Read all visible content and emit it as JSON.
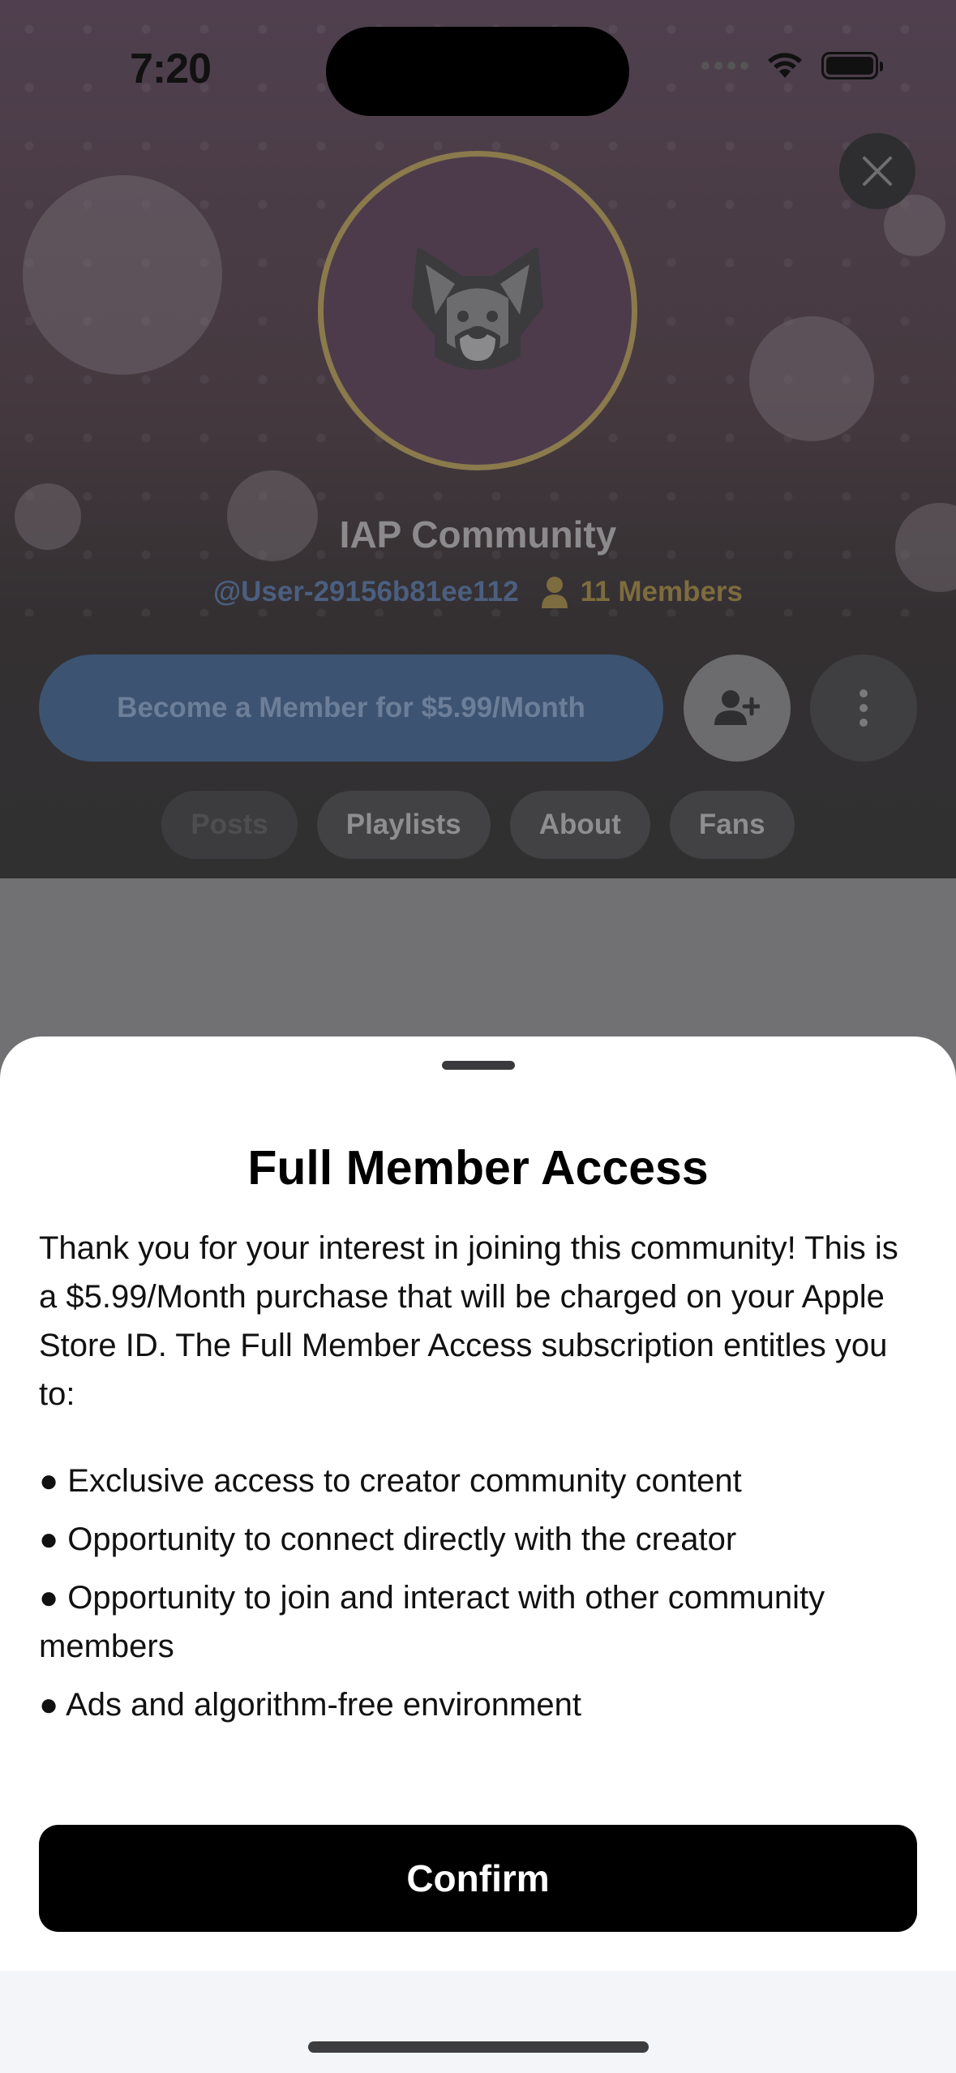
{
  "status_bar": {
    "time": "7:20"
  },
  "community": {
    "name": "IAP Community",
    "username": "@User-29156b81ee112",
    "members": "11 Members",
    "member_button": "Become a Member for $5.99/Month",
    "tabs": [
      "Posts",
      "Playlists",
      "About",
      "Fans"
    ],
    "active_tab": "Posts"
  },
  "sheet": {
    "title": "Full Member Access",
    "body": "Thank you for your interest in joining this community! This is a $5.99/Month purchase that will be charged on your Apple Store ID. The Full Member Access subscription entitles you to:",
    "bullets": [
      "Exclusive access to creator community content",
      "Opportunity to connect directly with the creator",
      "Opportunity to join and interact with other community members",
      "Ads and algorithm-free environment"
    ],
    "bullet_glyph": "●",
    "confirm_label": "Confirm"
  },
  "colors": {
    "accent_blue": "#3d5372",
    "gold": "#8a7a4c",
    "confirm_bg": "#000000"
  },
  "icons": {
    "close": "close-icon",
    "avatar": "dog-icon",
    "members": "person-icon",
    "add_user": "add-user-icon",
    "more": "more-vertical-icon",
    "wifi": "wifi-icon",
    "battery": "battery-icon"
  }
}
